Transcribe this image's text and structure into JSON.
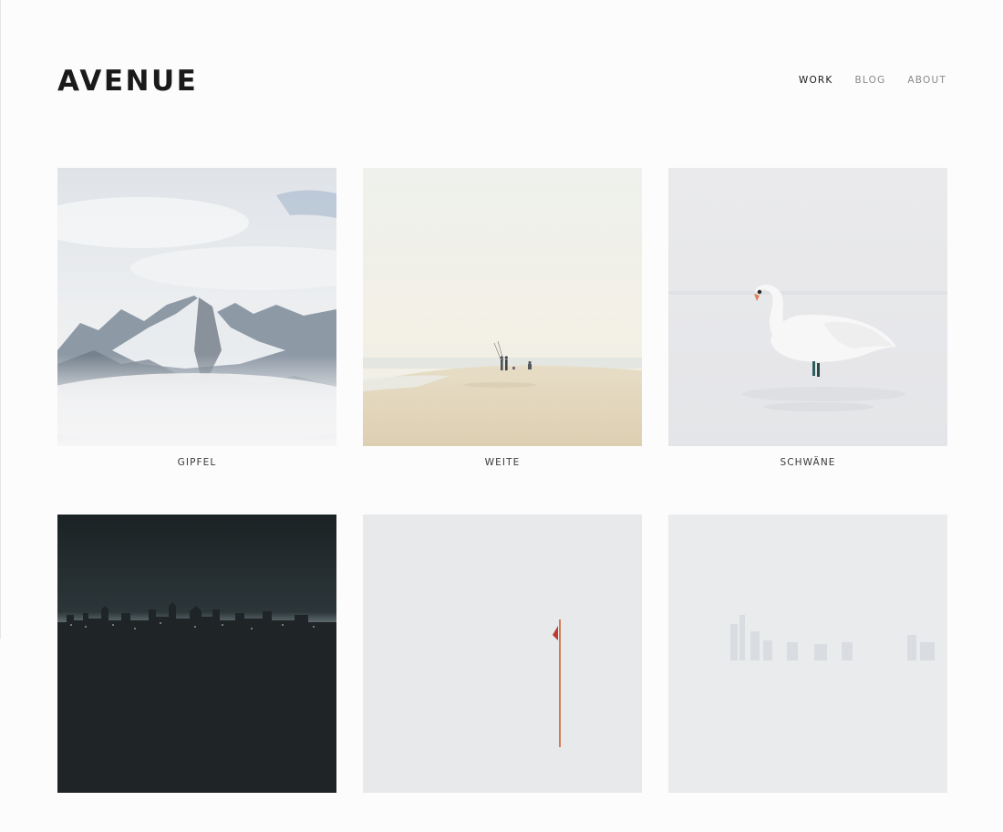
{
  "site": {
    "logo": "AVENUE"
  },
  "nav": {
    "items": [
      {
        "label": "WORK",
        "active": true
      },
      {
        "label": "BLOG",
        "active": false
      },
      {
        "label": "ABOUT",
        "active": false
      }
    ]
  },
  "gallery": {
    "items": [
      {
        "title": "GIPFEL",
        "image": "snowy-mountain-peaks"
      },
      {
        "title": "WEITE",
        "image": "beach-with-fishermen"
      },
      {
        "title": "SCHWÄNE",
        "image": "white-swan-in-water"
      },
      {
        "title": "",
        "image": "dark-city-skyline"
      },
      {
        "title": "",
        "image": "red-flag-in-fog"
      },
      {
        "title": "",
        "image": "misty-skyline"
      }
    ]
  }
}
